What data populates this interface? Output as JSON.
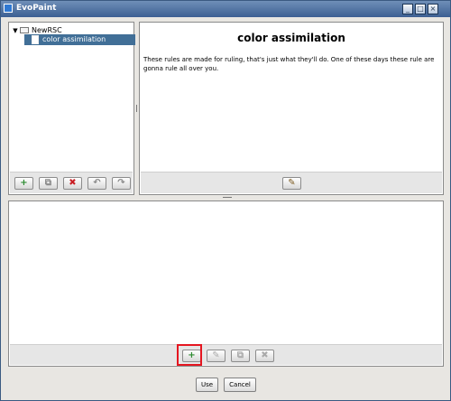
{
  "window": {
    "title": "EvoPaint",
    "title_icon": "app-icon",
    "controls": {
      "minimize": "_",
      "maximize": "□",
      "close": "×"
    }
  },
  "tree": {
    "root_label": "NewRSC",
    "selected_label": "color assimilation",
    "toolbar": {
      "add": "+",
      "copy": "⧉",
      "delete": "✖",
      "import": "↶",
      "export": "↷"
    }
  },
  "description": {
    "title": "color assimilation",
    "text": "These rules are made for ruling, that's just what they'll do. One of these days these rule are gonna rule all over you.",
    "edit": "✎"
  },
  "rules_toolbar": {
    "add": "+",
    "edit": "✎",
    "copy": "⧉",
    "delete": "✖"
  },
  "dialog_buttons": {
    "use": "Use",
    "cancel": "Cancel"
  },
  "colors": {
    "titlebar": "#3c5f93",
    "selection": "#416f97",
    "highlight": "#e51620"
  }
}
